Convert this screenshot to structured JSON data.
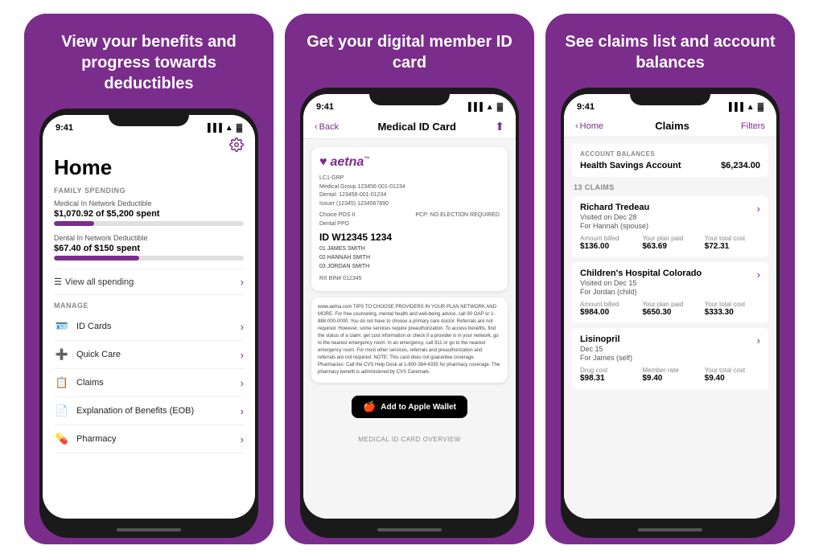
{
  "panels": [
    {
      "id": "panel1",
      "header": "View your benefits and progress towards deductibles",
      "status_time": "9:41",
      "screen": {
        "home_title": "Home",
        "family_spending_label": "FAMILY SPENDING",
        "deductibles": [
          {
            "label": "Medical In Network Deductible",
            "amount": "$1,070.92 of $5,200 spent",
            "progress": 21
          },
          {
            "label": "Dental In Network Deductible",
            "amount": "$67.40 of $150 spent",
            "progress": 45
          }
        ],
        "view_spending": "View all spending",
        "manage_label": "MANAGE",
        "menu_items": [
          {
            "icon": "🪪",
            "label": "ID Cards"
          },
          {
            "icon": "➕",
            "label": "Quick Care"
          },
          {
            "icon": "📋",
            "label": "Claims"
          },
          {
            "icon": "📄",
            "label": "Explanation of Benefits (EOB)"
          },
          {
            "icon": "💊",
            "label": "Pharmacy"
          }
        ]
      }
    },
    {
      "id": "panel2",
      "header": "Get your digital member ID card",
      "status_time": "9:41",
      "screen": {
        "back_label": "Back",
        "nav_title": "Medical ID Card",
        "card": {
          "group": "LC1-GRP",
          "medical_group": "Medical Group 123456-001-01234",
          "dental": "Dental: 123456-001-01234",
          "issuer": "Issuer (12345) 1234567890",
          "network": "Choice POS II",
          "dental_network": "Dental PPO",
          "pcp": "PCP: NO ELECTION REQUIRED",
          "id_label": "ID W12345 1234",
          "member1": "01 JAMES SMITH",
          "member2": "02 HANNAH SMITH",
          "member3": "03 JORDAN SMITH",
          "election": "PCP: NO ELECTION REQUIRED",
          "rx": "RX BIN# 012345"
        },
        "back_card_text": "www.aetna.com  TIPS TO CHOOSE PROVIDERS IN YOUR PLAN NETWORK AND MORE. For free counseling, mental health and well-being advice, call 90 OAP or 1-888-000-0000. You do not have to choose a primary care doctor. Referrals are not required. However, some services require preauthorization. To access benefits, find the status of a claim, get cost information or check if a provider is in your network, go to the nearest emergency room. In an emergency, call 911 or go to the nearest emergency room. For most other services, referrals and preauthorization and referrals are not required. NOTE: This card does not guarantee coverage. Pharmacies: Call the CVS Help Desk at 1-800-364-4335 for pharmacy coverage. The pharmacy benefit is administered by CVS Caremark.",
        "apple_wallet_label": "Add to Apple Wallet",
        "overview_label": "MEDICAL ID CARD OVERVIEW"
      }
    },
    {
      "id": "panel3",
      "header": "See claims list and account balances",
      "status_time": "9:41",
      "screen": {
        "back_label": "Home",
        "nav_title": "Claims",
        "filters_label": "Filters",
        "balance_section_label": "ACCOUNT BALANCES",
        "balance_name": "Health Savings Account",
        "balance_amount": "$6,234.00",
        "claims_count_label": "13 CLAIMS",
        "claims": [
          {
            "name": "Richard Tredeau",
            "date": "Visited on Dec 28",
            "for": "For Hannah (spouse)",
            "amount_billed_label": "Amount billed",
            "amount_billed": "$136.00",
            "plan_paid_label": "Your plan paid",
            "plan_paid": "$63.69",
            "total_cost_label": "Your total cost",
            "total_cost": "$72.31"
          },
          {
            "name": "Children's Hospital Colorado",
            "date": "Visited on Dec 15",
            "for": "For Jordan (child)",
            "amount_billed_label": "Amount billed",
            "amount_billed": "$984.00",
            "plan_paid_label": "Your plan paid",
            "plan_paid": "$650.30",
            "total_cost_label": "Your total cost",
            "total_cost": "$333.30"
          },
          {
            "name": "Lisinopril",
            "date": "Dec 15",
            "for": "For James (self)",
            "amount_billed_label": "Drug cost",
            "amount_billed": "$98.31",
            "plan_paid_label": "Member rate",
            "plan_paid": "$9.40",
            "total_cost_label": "Your total cost",
            "total_cost": "$9.40"
          }
        ]
      }
    }
  ]
}
